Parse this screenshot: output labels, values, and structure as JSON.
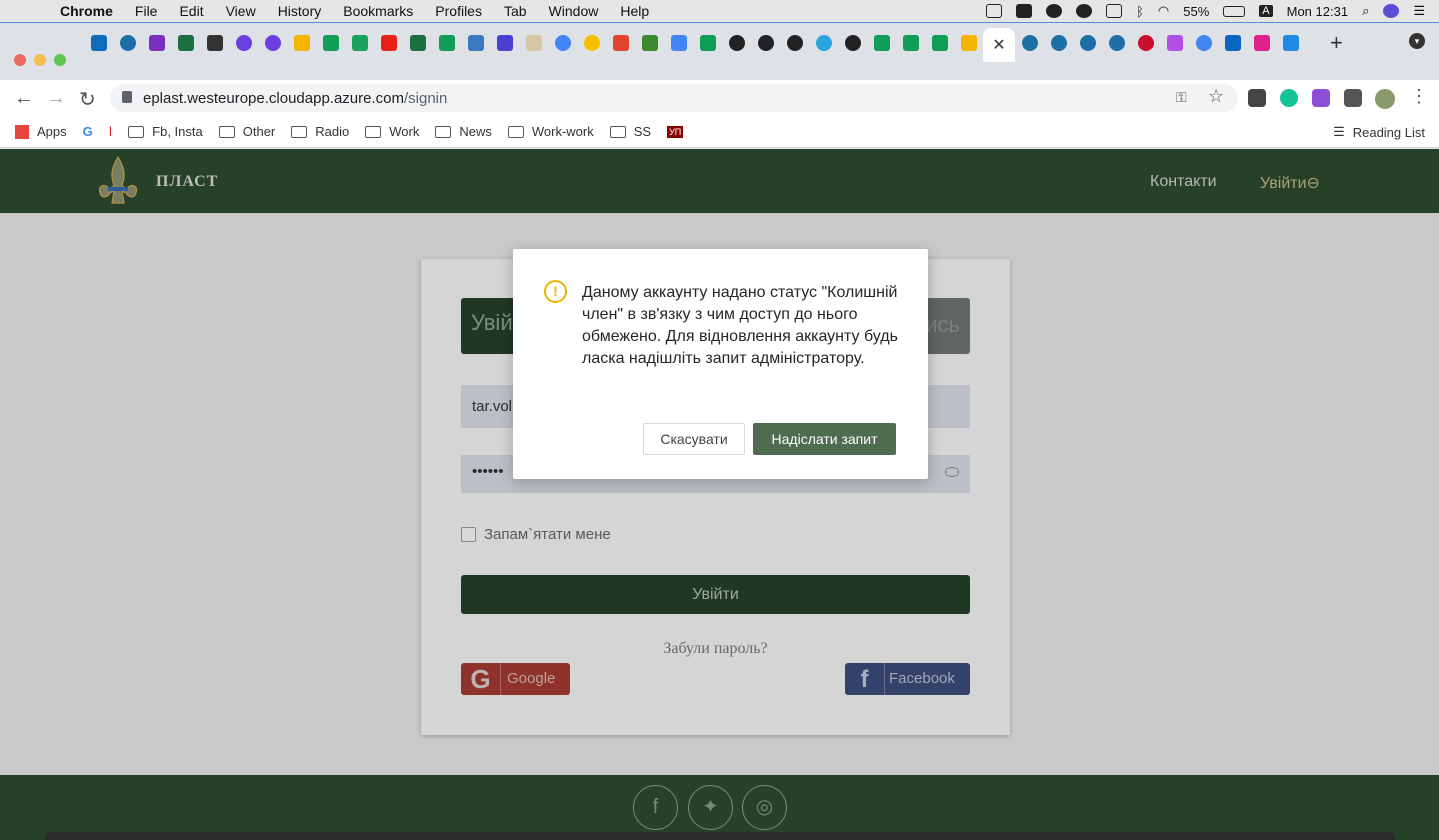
{
  "menubar": {
    "app": "Chrome",
    "items": [
      "File",
      "Edit",
      "View",
      "History",
      "Bookmarks",
      "Profiles",
      "Tab",
      "Window",
      "Help"
    ],
    "battery": "55%",
    "input_source": "A",
    "clock": "Mon 12:31"
  },
  "browser": {
    "url_host": "eplast.westeurope.cloudapp.azure.com",
    "url_path": "/signin",
    "active_tab_close": "✕",
    "new_tab": "+"
  },
  "bookmarks": {
    "items": [
      "Apps",
      "Fb, Insta",
      "Other",
      "Radio",
      "Work",
      "News",
      "Work-work",
      "SS"
    ],
    "reading_list": "Reading List",
    "up_badge": "УП"
  },
  "site": {
    "logo_text": "ПЛАСТ",
    "nav_contacts": "Контакти",
    "nav_login": "Увійти"
  },
  "form": {
    "tab_login": "Увій",
    "tab_register": "ись",
    "email_value": "tar.vol",
    "password_mask": "••••••",
    "remember": "Запам`ятати мене",
    "login_button": "Увійти",
    "forgot": "Забули пароль?",
    "google": "Google",
    "facebook": "Facebook"
  },
  "modal": {
    "icon": "!",
    "message": "Даному аккаунту надано статус \"Колишній член\" в зв'язку з чим доступ до нього обмежено. Для відновлення аккаунту будь ласка надішліть запит адміністратору.",
    "cancel": "Скасувати",
    "send": "Надіслати запит"
  },
  "colors": {
    "header_green": "#2c4a2e",
    "button_green": "#24402a",
    "modal_primary": "#4f6b50",
    "warning": "#f0b400",
    "google_red": "#a33a32",
    "facebook_blue": "#3b4a7a"
  }
}
